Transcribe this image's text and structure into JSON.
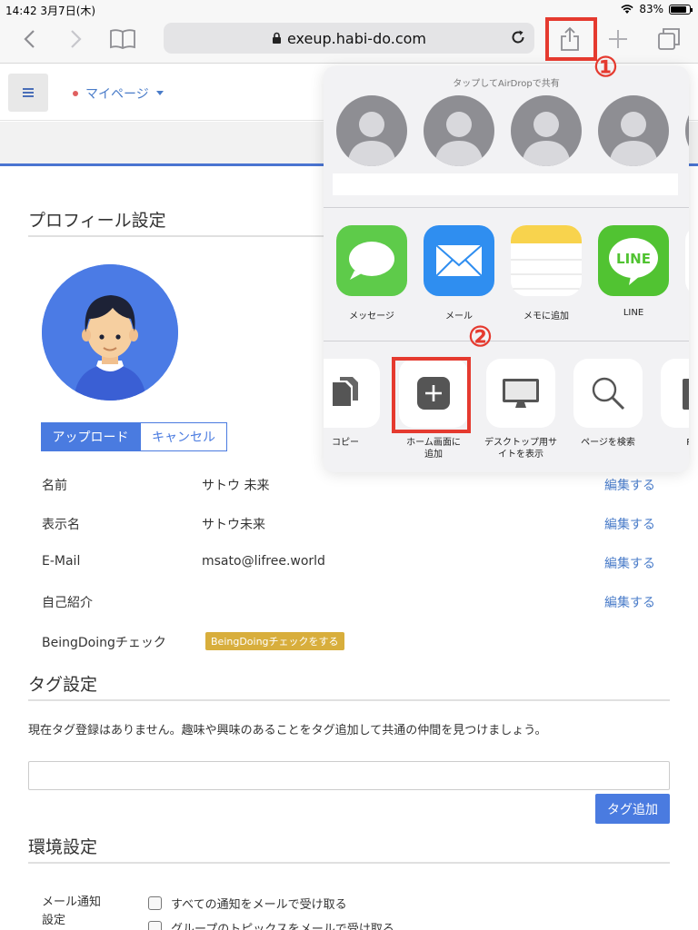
{
  "status_bar": {
    "time": "14:42",
    "date": "3月7日(木)",
    "battery": "83%",
    "battery_level": 0.83
  },
  "browser": {
    "url": "exeup.habi-do.com"
  },
  "annotations": {
    "step1": "①",
    "step2": "②",
    "color": "#e53a2f"
  },
  "header": {
    "mypage_label": "マイページ"
  },
  "profile": {
    "section_title": "プロフィール設定",
    "upload_label": "アップロード",
    "cancel_label": "キャンセル",
    "rows": [
      {
        "label": "名前",
        "value": "サトウ 未来",
        "edit": "編集する"
      },
      {
        "label": "表示名",
        "value": "サトウ未来",
        "edit": "編集する"
      },
      {
        "label": "E-Mail",
        "value": "msato@lifree.world",
        "edit": "編集する"
      },
      {
        "label": "自己紹介",
        "value": "",
        "edit": "編集する"
      }
    ],
    "beingdoing_label": "BeingDoingチェック",
    "beingdoing_button": "BeingDoingチェックをする"
  },
  "tags": {
    "section_title": "タグ設定",
    "empty_text": "現在タグ登録はありません。趣味や興味のあることをタグ追加して共通の仲間を見つけましょう。",
    "input_value": "",
    "add_button": "タグ追加"
  },
  "environment": {
    "section_title": "環境設定",
    "mail_label": "メール通知設定",
    "options": [
      "すべての通知をメールで受け取る",
      "グループのトピックスをメールで受け取る"
    ]
  },
  "share_sheet": {
    "airdrop_title": "タップしてAirDropで共有",
    "apps": [
      {
        "label": "メッセージ",
        "icon": "messages-icon"
      },
      {
        "label": "メール",
        "icon": "mail-icon"
      },
      {
        "label": "メモに追加",
        "icon": "notes-icon"
      },
      {
        "label": "LINE",
        "icon": "line-icon",
        "icon_text": "LINE"
      }
    ],
    "actions": [
      {
        "label": "コピー",
        "icon": "copy-icon"
      },
      {
        "label_line1": "ホーム画面に",
        "label_line2": "追加",
        "icon": "add-to-home-icon"
      },
      {
        "label_line1": "デスクトップ用サ",
        "label_line2": "イトを表示",
        "icon": "desktop-icon"
      },
      {
        "label": "ページを検索",
        "icon": "find-icon"
      },
      {
        "label": "PDF",
        "icon": "pdf-icon"
      }
    ]
  },
  "colors": {
    "accent": "#4a7be0",
    "badge": "#d8ae3c",
    "highlight": "#e53a2f"
  }
}
